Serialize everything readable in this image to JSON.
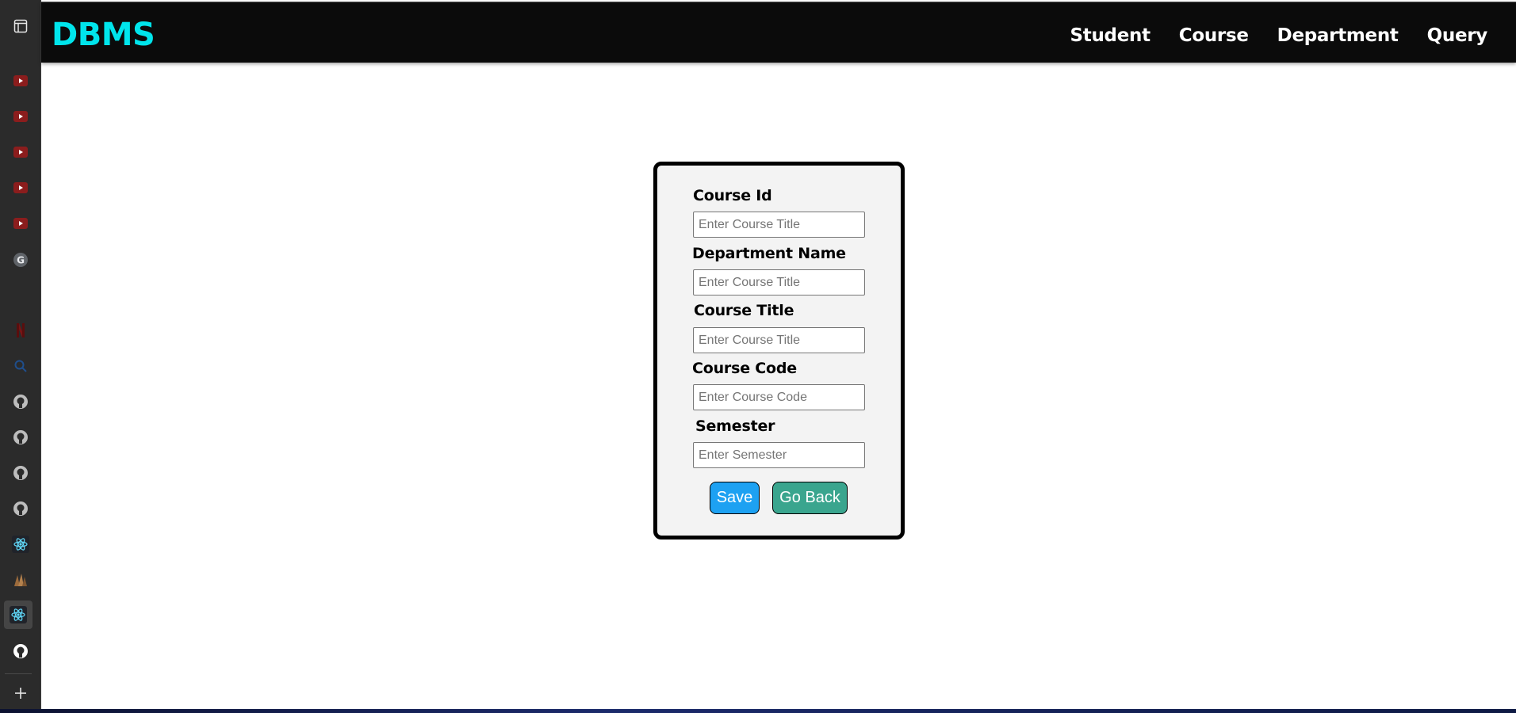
{
  "sidebar": {
    "icons": [
      {
        "name": "tab-panel-icon",
        "glyph": "▣",
        "color": "#e6e6e6"
      },
      {
        "name": "youtube-icon",
        "glyph": "▶",
        "color": "#c4302b"
      },
      {
        "name": "youtube-icon",
        "glyph": "▶",
        "color": "#c4302b"
      },
      {
        "name": "youtube-icon",
        "glyph": "▶",
        "color": "#c4302b"
      },
      {
        "name": "youtube-icon",
        "glyph": "▶",
        "color": "#c4302b"
      },
      {
        "name": "youtube-icon",
        "glyph": "▶",
        "color": "#c4302b"
      },
      {
        "name": "google-icon",
        "glyph": "G",
        "color": "#9aa0a6"
      },
      {
        "name": "netflix-icon",
        "glyph": "N",
        "color": "#8b1a1a"
      },
      {
        "name": "search-icon",
        "glyph": "⌕",
        "color": "#1f4e8c"
      },
      {
        "name": "github-icon",
        "glyph": "●",
        "color": "#bdbdbd"
      },
      {
        "name": "github-icon",
        "glyph": "●",
        "color": "#bdbdbd"
      },
      {
        "name": "github-icon",
        "glyph": "●",
        "color": "#bdbdbd"
      },
      {
        "name": "github-icon",
        "glyph": "●",
        "color": "#bdbdbd"
      },
      {
        "name": "react-icon",
        "glyph": "⚛",
        "color": "#61dafb"
      },
      {
        "name": "app-icon",
        "glyph": "▲",
        "color": "#9c6b3c"
      },
      {
        "name": "react-icon",
        "glyph": "⚛",
        "color": "#61dafb"
      },
      {
        "name": "github-icon",
        "glyph": "●",
        "color": "#ffffff"
      },
      {
        "name": "add-icon",
        "glyph": "+",
        "color": "#e6e6e6"
      }
    ]
  },
  "navbar": {
    "brand": "DBMS",
    "links": [
      "Student",
      "Course",
      "Department",
      "Query"
    ],
    "brand_color": "#00e5ec",
    "background": "#0b0b0b"
  },
  "form": {
    "fields": [
      {
        "label": "Course Id",
        "placeholder": "Enter Course Title",
        "value": ""
      },
      {
        "label": "Department Name",
        "placeholder": "Enter Course Title",
        "value": ""
      },
      {
        "label": "Course Title",
        "placeholder": "Enter Course Title",
        "value": ""
      },
      {
        "label": "Course Code",
        "placeholder": "Enter Course Code",
        "value": ""
      },
      {
        "label": "Semester",
        "placeholder": "Enter Semester",
        "value": ""
      }
    ],
    "save_label": "Save",
    "back_label": "Go Back",
    "save_color": "#1da1f2",
    "back_color": "#3aa58e"
  }
}
